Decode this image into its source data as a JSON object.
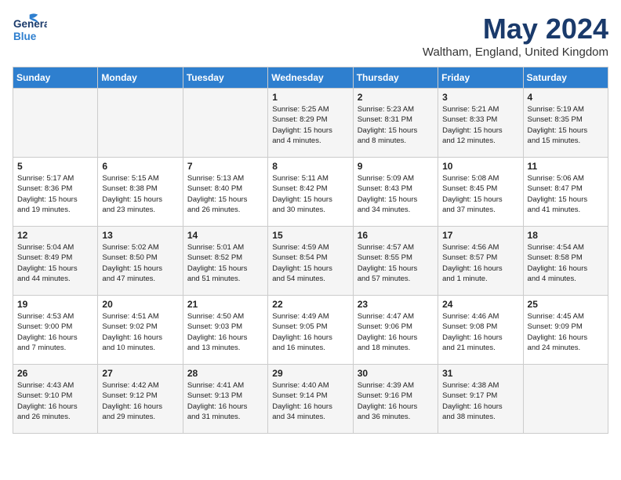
{
  "header": {
    "logo_general": "General",
    "logo_blue": "Blue",
    "month": "May 2024",
    "location": "Waltham, England, United Kingdom"
  },
  "weekdays": [
    "Sunday",
    "Monday",
    "Tuesday",
    "Wednesday",
    "Thursday",
    "Friday",
    "Saturday"
  ],
  "weeks": [
    [
      {
        "day": "",
        "info": ""
      },
      {
        "day": "",
        "info": ""
      },
      {
        "day": "",
        "info": ""
      },
      {
        "day": "1",
        "info": "Sunrise: 5:25 AM\nSunset: 8:29 PM\nDaylight: 15 hours\nand 4 minutes."
      },
      {
        "day": "2",
        "info": "Sunrise: 5:23 AM\nSunset: 8:31 PM\nDaylight: 15 hours\nand 8 minutes."
      },
      {
        "day": "3",
        "info": "Sunrise: 5:21 AM\nSunset: 8:33 PM\nDaylight: 15 hours\nand 12 minutes."
      },
      {
        "day": "4",
        "info": "Sunrise: 5:19 AM\nSunset: 8:35 PM\nDaylight: 15 hours\nand 15 minutes."
      }
    ],
    [
      {
        "day": "5",
        "info": "Sunrise: 5:17 AM\nSunset: 8:36 PM\nDaylight: 15 hours\nand 19 minutes."
      },
      {
        "day": "6",
        "info": "Sunrise: 5:15 AM\nSunset: 8:38 PM\nDaylight: 15 hours\nand 23 minutes."
      },
      {
        "day": "7",
        "info": "Sunrise: 5:13 AM\nSunset: 8:40 PM\nDaylight: 15 hours\nand 26 minutes."
      },
      {
        "day": "8",
        "info": "Sunrise: 5:11 AM\nSunset: 8:42 PM\nDaylight: 15 hours\nand 30 minutes."
      },
      {
        "day": "9",
        "info": "Sunrise: 5:09 AM\nSunset: 8:43 PM\nDaylight: 15 hours\nand 34 minutes."
      },
      {
        "day": "10",
        "info": "Sunrise: 5:08 AM\nSunset: 8:45 PM\nDaylight: 15 hours\nand 37 minutes."
      },
      {
        "day": "11",
        "info": "Sunrise: 5:06 AM\nSunset: 8:47 PM\nDaylight: 15 hours\nand 41 minutes."
      }
    ],
    [
      {
        "day": "12",
        "info": "Sunrise: 5:04 AM\nSunset: 8:49 PM\nDaylight: 15 hours\nand 44 minutes."
      },
      {
        "day": "13",
        "info": "Sunrise: 5:02 AM\nSunset: 8:50 PM\nDaylight: 15 hours\nand 47 minutes."
      },
      {
        "day": "14",
        "info": "Sunrise: 5:01 AM\nSunset: 8:52 PM\nDaylight: 15 hours\nand 51 minutes."
      },
      {
        "day": "15",
        "info": "Sunrise: 4:59 AM\nSunset: 8:54 PM\nDaylight: 15 hours\nand 54 minutes."
      },
      {
        "day": "16",
        "info": "Sunrise: 4:57 AM\nSunset: 8:55 PM\nDaylight: 15 hours\nand 57 minutes."
      },
      {
        "day": "17",
        "info": "Sunrise: 4:56 AM\nSunset: 8:57 PM\nDaylight: 16 hours\nand 1 minute."
      },
      {
        "day": "18",
        "info": "Sunrise: 4:54 AM\nSunset: 8:58 PM\nDaylight: 16 hours\nand 4 minutes."
      }
    ],
    [
      {
        "day": "19",
        "info": "Sunrise: 4:53 AM\nSunset: 9:00 PM\nDaylight: 16 hours\nand 7 minutes."
      },
      {
        "day": "20",
        "info": "Sunrise: 4:51 AM\nSunset: 9:02 PM\nDaylight: 16 hours\nand 10 minutes."
      },
      {
        "day": "21",
        "info": "Sunrise: 4:50 AM\nSunset: 9:03 PM\nDaylight: 16 hours\nand 13 minutes."
      },
      {
        "day": "22",
        "info": "Sunrise: 4:49 AM\nSunset: 9:05 PM\nDaylight: 16 hours\nand 16 minutes."
      },
      {
        "day": "23",
        "info": "Sunrise: 4:47 AM\nSunset: 9:06 PM\nDaylight: 16 hours\nand 18 minutes."
      },
      {
        "day": "24",
        "info": "Sunrise: 4:46 AM\nSunset: 9:08 PM\nDaylight: 16 hours\nand 21 minutes."
      },
      {
        "day": "25",
        "info": "Sunrise: 4:45 AM\nSunset: 9:09 PM\nDaylight: 16 hours\nand 24 minutes."
      }
    ],
    [
      {
        "day": "26",
        "info": "Sunrise: 4:43 AM\nSunset: 9:10 PM\nDaylight: 16 hours\nand 26 minutes."
      },
      {
        "day": "27",
        "info": "Sunrise: 4:42 AM\nSunset: 9:12 PM\nDaylight: 16 hours\nand 29 minutes."
      },
      {
        "day": "28",
        "info": "Sunrise: 4:41 AM\nSunset: 9:13 PM\nDaylight: 16 hours\nand 31 minutes."
      },
      {
        "day": "29",
        "info": "Sunrise: 4:40 AM\nSunset: 9:14 PM\nDaylight: 16 hours\nand 34 minutes."
      },
      {
        "day": "30",
        "info": "Sunrise: 4:39 AM\nSunset: 9:16 PM\nDaylight: 16 hours\nand 36 minutes."
      },
      {
        "day": "31",
        "info": "Sunrise: 4:38 AM\nSunset: 9:17 PM\nDaylight: 16 hours\nand 38 minutes."
      },
      {
        "day": "",
        "info": ""
      }
    ]
  ]
}
